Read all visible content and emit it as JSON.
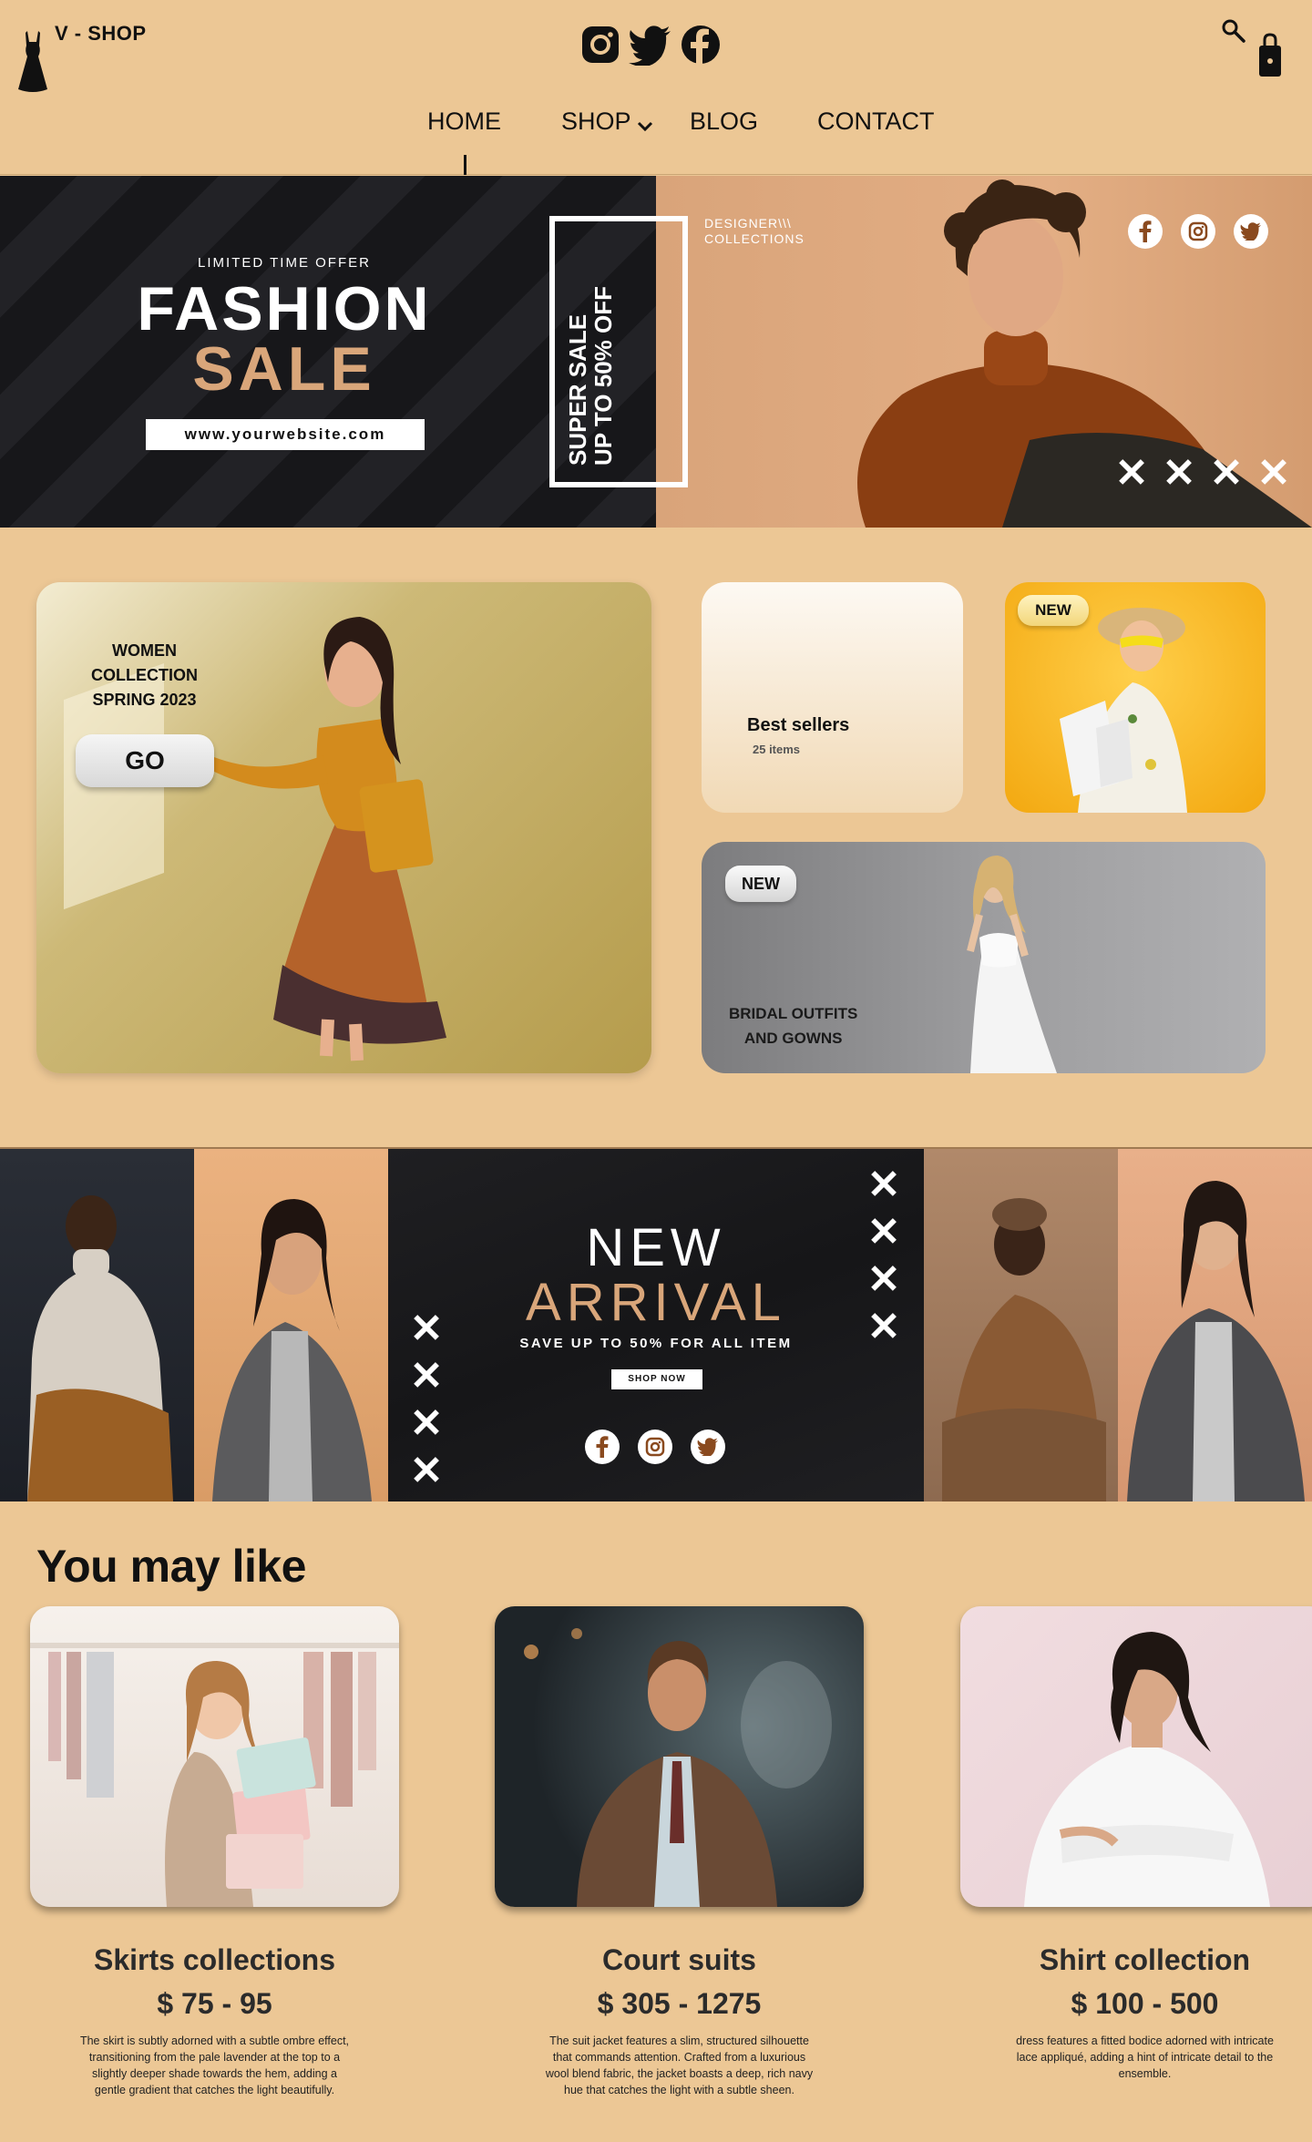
{
  "header": {
    "brand": "V - SHOP",
    "nav": {
      "home": "HOME",
      "shop": "SHOP",
      "blog": "BLOG",
      "contact": "CONTACT"
    },
    "icons": [
      "dress-logo-icon",
      "instagram-icon",
      "twitter-icon",
      "facebook-icon",
      "search-icon",
      "shopping-bag-icon"
    ]
  },
  "hero": {
    "limited": "LIMITED TIME OFFER",
    "fashion": "FASHION",
    "sale": "SALE",
    "url": "www.yourwebsite.com",
    "super_sale": "SUPER SALE",
    "up_to": "UP TO 50% OFF",
    "designer_line1": "DESIGNER\\\\\\",
    "designer_line2": "COLLECTIONS",
    "accent": "#d9a67a"
  },
  "promos": {
    "women_line1": "WOMEN",
    "women_line2": "COLLECTION",
    "women_line3": "SPRING 2023",
    "go": "GO",
    "best_title": "Best sellers",
    "best_sub": "25 items",
    "new_badge": "NEW",
    "bridal_line1": "BRIDAL OUTFITS",
    "bridal_line2": "AND GOWNS"
  },
  "arrival": {
    "new": "NEW",
    "arrival": "ARRIVAL",
    "save": "SAVE UP TO 50% FOR ALL ITEM",
    "shop_now": "SHOP NOW"
  },
  "you_may_like": {
    "title": "You may like",
    "products": [
      {
        "name": "Skirts collections",
        "price": "$ 75 - 95",
        "desc": "The skirt is subtly adorned with a subtle ombre effect, transitioning from the pale lavender at the top to a slightly deeper shade towards the hem, adding a gentle gradient that catches the light beautifully."
      },
      {
        "name": "Court suits",
        "price": "$ 305 - 1275",
        "desc": "The suit jacket features a slim, structured silhouette that commands attention. Crafted from a luxurious wool blend fabric, the jacket boasts a deep, rich navy hue that catches the light with a subtle sheen."
      },
      {
        "name": "Shirt collection",
        "price": "$ 100 - 500",
        "desc": "dress features a fitted bodice adorned with intricate lace appliqué, adding a hint of intricate detail to the ensemble."
      }
    ]
  }
}
